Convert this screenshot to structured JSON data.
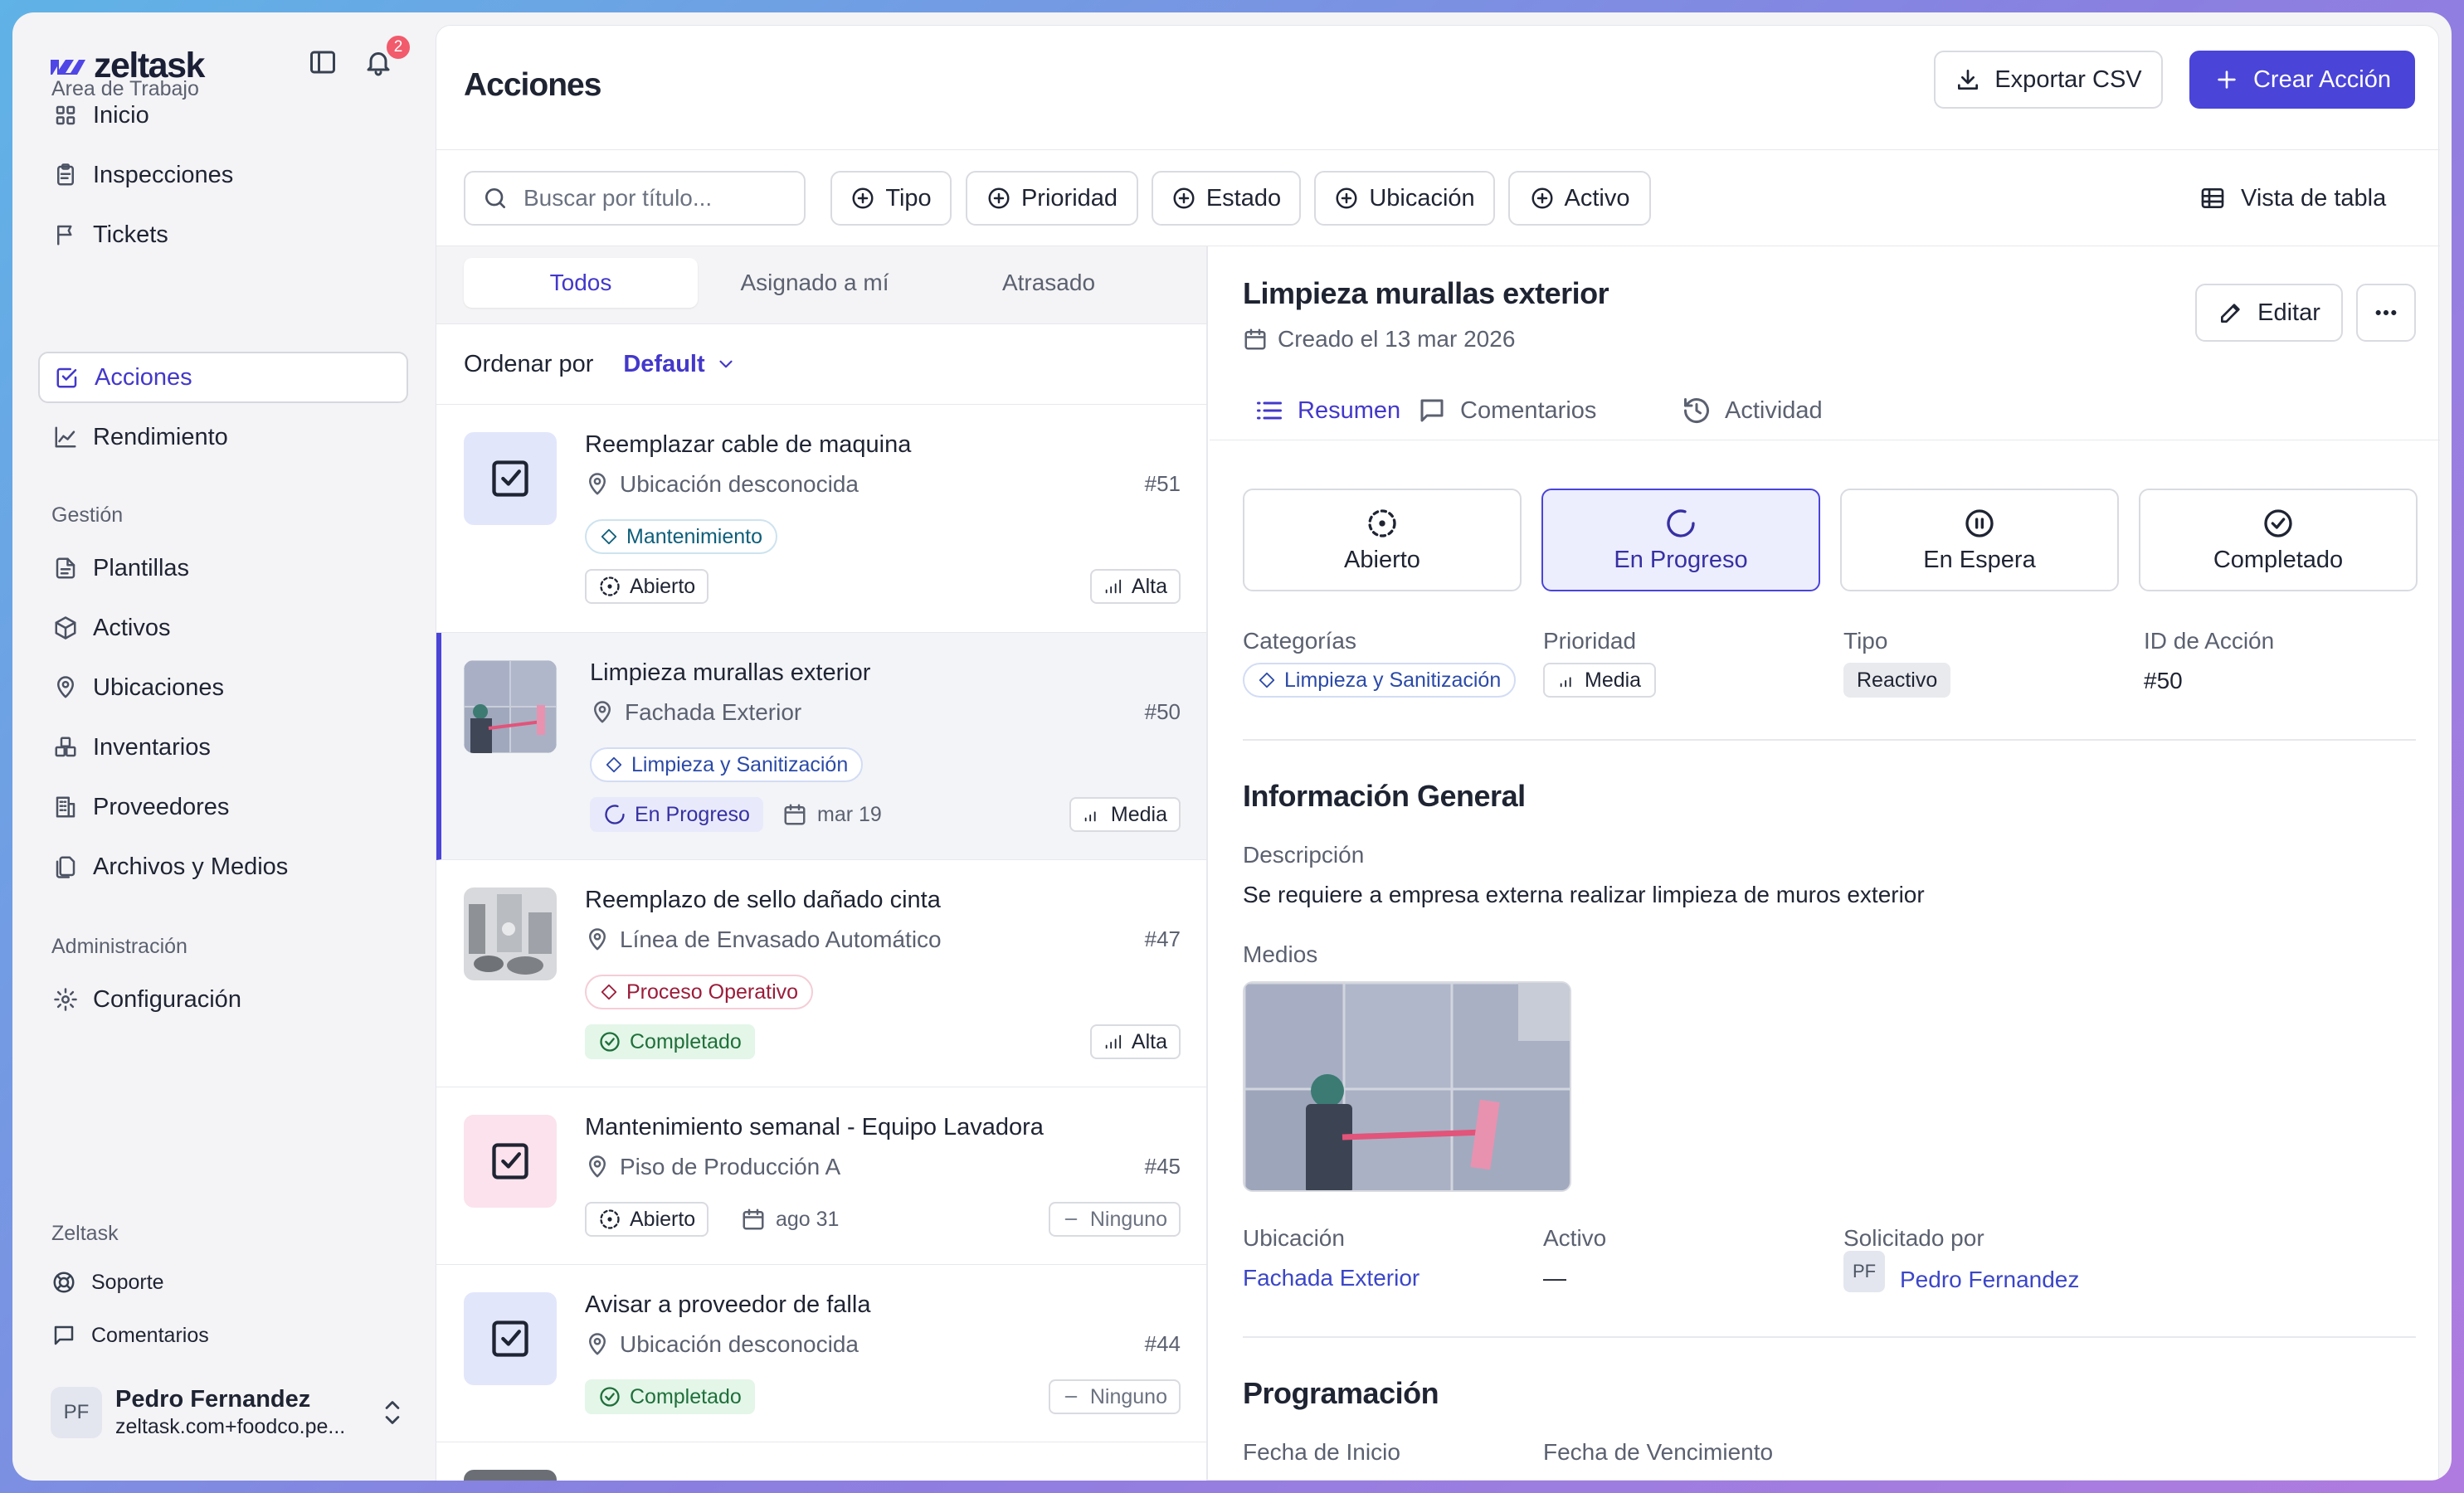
{
  "app": {
    "name": "zeltask",
    "notification_count": "2"
  },
  "sidebar": {
    "section_workspace": "Area de Trabajo",
    "workspace_items": [
      {
        "label": "Inicio",
        "icon": "grid-icon"
      },
      {
        "label": "Inspecciones",
        "icon": "clipboard-icon"
      },
      {
        "label": "Tickets",
        "icon": "flag-icon"
      },
      {
        "label": "Acciones",
        "icon": "check-square-icon",
        "active": true
      },
      {
        "label": "Rendimiento",
        "icon": "chart-line-icon"
      }
    ],
    "section_management": "Gestión",
    "management_items": [
      {
        "label": "Plantillas",
        "icon": "file-icon"
      },
      {
        "label": "Activos",
        "icon": "cube-icon"
      },
      {
        "label": "Ubicaciones",
        "icon": "map-pin-icon"
      },
      {
        "label": "Inventarios",
        "icon": "boxes-icon"
      },
      {
        "label": "Proveedores",
        "icon": "building-icon"
      },
      {
        "label": "Archivos y Medios",
        "icon": "files-icon"
      }
    ],
    "section_admin": "Administración",
    "admin_items": [
      {
        "label": "Configuración",
        "icon": "gear-icon"
      }
    ],
    "section_footer": "Zeltask",
    "footer_items": [
      {
        "label": "Soporte",
        "icon": "lifebuoy-icon"
      },
      {
        "label": "Comentarios",
        "icon": "message-icon"
      }
    ],
    "user": {
      "initials": "PF",
      "name": "Pedro Fernandez",
      "email": "zeltask.com+foodco.pe..."
    }
  },
  "header": {
    "title": "Acciones",
    "export_label": "Exportar CSV",
    "create_label": "Crear Acción"
  },
  "filters": {
    "search_placeholder": "Buscar por título...",
    "chips": [
      "Tipo",
      "Prioridad",
      "Estado",
      "Ubicación",
      "Activo"
    ],
    "view_label": "Vista de tabla"
  },
  "list": {
    "tabs": [
      "Todos",
      "Asignado a mí",
      "Atrasado"
    ],
    "active_tab": "Todos",
    "sort_label": "Ordenar por",
    "sort_value": "Default",
    "items": [
      {
        "title": "Reemplazar cable de maquina",
        "location": "Ubicación desconocida",
        "number": "#51",
        "category": "Mantenimiento",
        "status": "Abierto",
        "date": "",
        "priority": "Alta"
      },
      {
        "title": "Limpieza murallas exterior",
        "location": "Fachada Exterior",
        "number": "#50",
        "category": "Limpieza y Sanitización",
        "status": "En Progreso",
        "date": "mar 19",
        "priority": "Media"
      },
      {
        "title": "Reemplazo de sello dañado cinta",
        "location": "Línea de Envasado Automático",
        "number": "#47",
        "category": "Proceso Operativo",
        "status": "Completado",
        "date": "",
        "priority": "Alta"
      },
      {
        "title": "Mantenimiento semanal - Equipo Lavadora",
        "location": "Piso de Producción A",
        "number": "#45",
        "category": "",
        "status": "Abierto",
        "date": "ago 31",
        "priority": "Ninguno"
      },
      {
        "title": "Avisar a proveedor de falla",
        "location": "Ubicación desconocida",
        "number": "#44",
        "category": "",
        "status": "Completado",
        "date": "",
        "priority": "Ninguno"
      }
    ]
  },
  "detail": {
    "title": "Limpieza murallas exterior",
    "created": "Creado el 13 mar 2026",
    "edit_label": "Editar",
    "tabs": [
      "Resumen",
      "Comentarios",
      "Actividad"
    ],
    "active_tab": "Resumen",
    "statuses": [
      "Abierto",
      "En Progreso",
      "En Espera",
      "Completado"
    ],
    "active_status": "En Progreso",
    "fields": {
      "categories_label": "Categorías",
      "categories_value": "Limpieza y Sanitización",
      "priority_label": "Prioridad",
      "priority_value": "Media",
      "type_label": "Tipo",
      "type_value": "Reactivo",
      "id_label": "ID de Acción",
      "id_value": "#50"
    },
    "general_heading": "Información General",
    "description_label": "Descripción",
    "description": "Se requiere a empresa externa realizar limpieza de muros exterior",
    "media_label": "Medios",
    "location_label": "Ubicación",
    "location_value": "Fachada Exterior",
    "asset_label": "Activo",
    "asset_value": "—",
    "requested_label": "Solicitado por",
    "requested_initials": "PF",
    "requested_value": "Pedro Fernandez",
    "schedule_heading": "Programación",
    "start_label": "Fecha de Inicio",
    "due_label": "Fecha de Vencimiento"
  },
  "colors": {
    "accent": "#4a44d8",
    "accent_text": "#4338ca",
    "badge": "#f15b6c",
    "done_bg": "#e3f6e8",
    "progress_bg": "#e8eafb"
  }
}
